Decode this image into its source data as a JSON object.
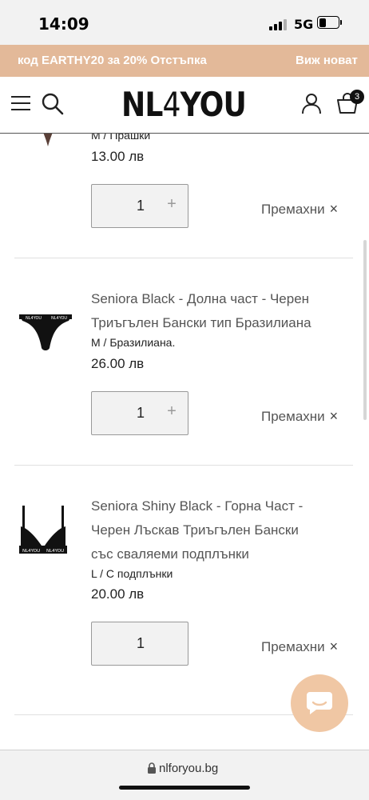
{
  "status_bar": {
    "time": "14:09",
    "network": "5G"
  },
  "promo": {
    "text": "код EARTHY20 за 20% Отстъпка",
    "link": "Виж новат"
  },
  "header": {
    "logo_left": "NL",
    "logo_four": "4",
    "logo_right": "YOU",
    "cart_count": "3",
    "icons": [
      "menu-icon",
      "search-icon",
      "account-icon",
      "cart-icon"
    ]
  },
  "cart": {
    "remove_label": "Премахни",
    "remove_icon": "×",
    "plus_icon": "+",
    "items": [
      {
        "title": "",
        "variant": "M / Прашки",
        "price": "13.00 лв",
        "quantity": "1"
      },
      {
        "title_line1": "Seniora Black - Долна част - Черен",
        "title_line2": "Триъгълен Бански тип Бразилиана",
        "variant": "M / Бразилиана.",
        "price": "26.00 лв",
        "quantity": "1"
      },
      {
        "title_line1": "Seniora Shiny Black - Горна Част -",
        "title_line2": "Черен Лъскав Триъгълен Бански",
        "title_line3": "със сваляеми подплънки",
        "variant": "L / С подплънки",
        "price": "20.00 лв",
        "quantity": "1"
      }
    ]
  },
  "browser": {
    "url": "nlforyou.bg"
  },
  "colors": {
    "promo_bg": "#e3b999",
    "chat_bg": "#f0c7a4",
    "text_gray": "#555555"
  }
}
